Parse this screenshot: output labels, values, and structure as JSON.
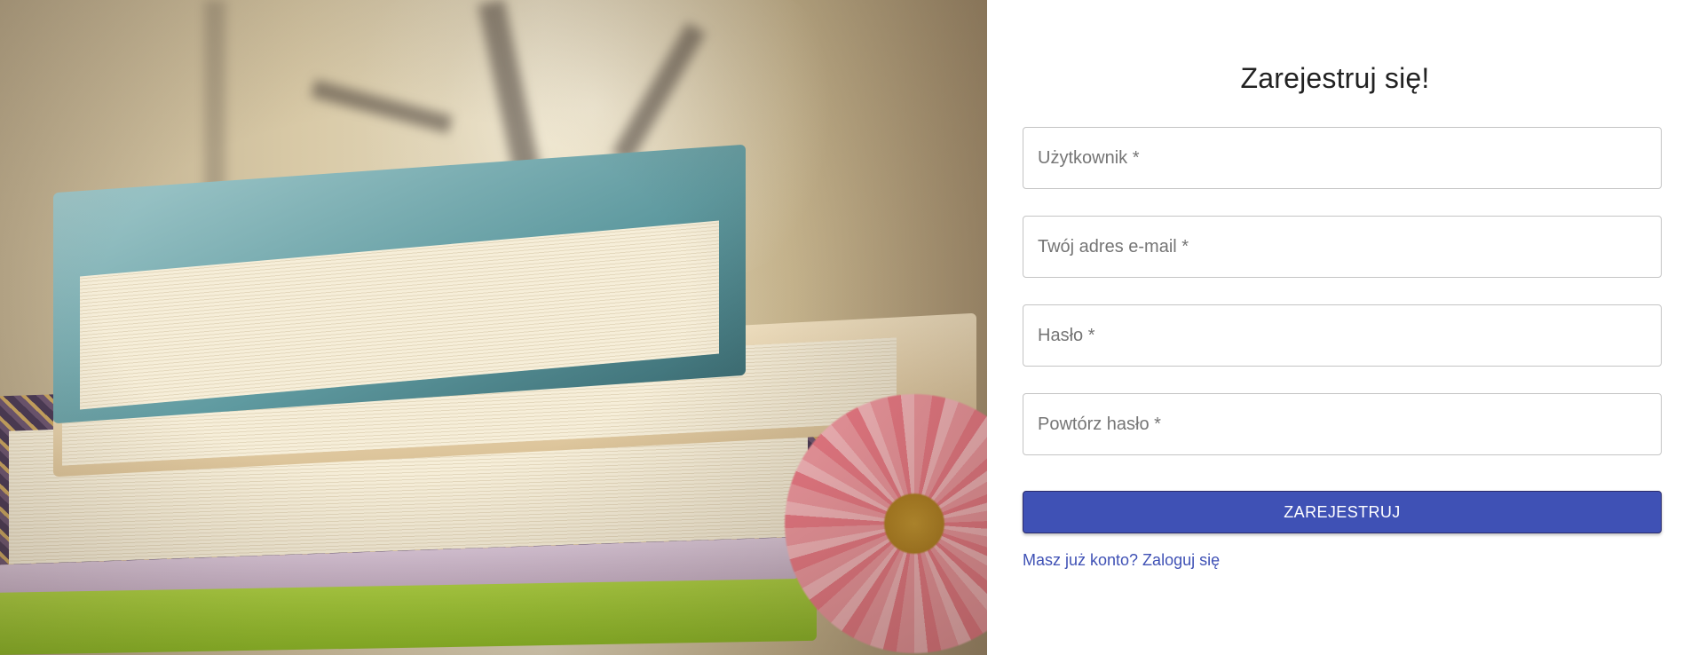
{
  "form": {
    "title": "Zarejestruj się!",
    "fields": [
      {
        "placeholder": "Użytkownik *",
        "value": ""
      },
      {
        "placeholder": "Twój adres e-mail *",
        "value": ""
      },
      {
        "placeholder": "Hasło *",
        "value": ""
      },
      {
        "placeholder": "Powtórz hasło *",
        "value": ""
      }
    ],
    "submit_label": "ZAREJESTRUJ",
    "login_link_label": "Masz już konto? Zaloguj się"
  },
  "colors": {
    "accent": "#3f51b5",
    "field_border": "#c4c4c4",
    "title_text": "#222222"
  }
}
